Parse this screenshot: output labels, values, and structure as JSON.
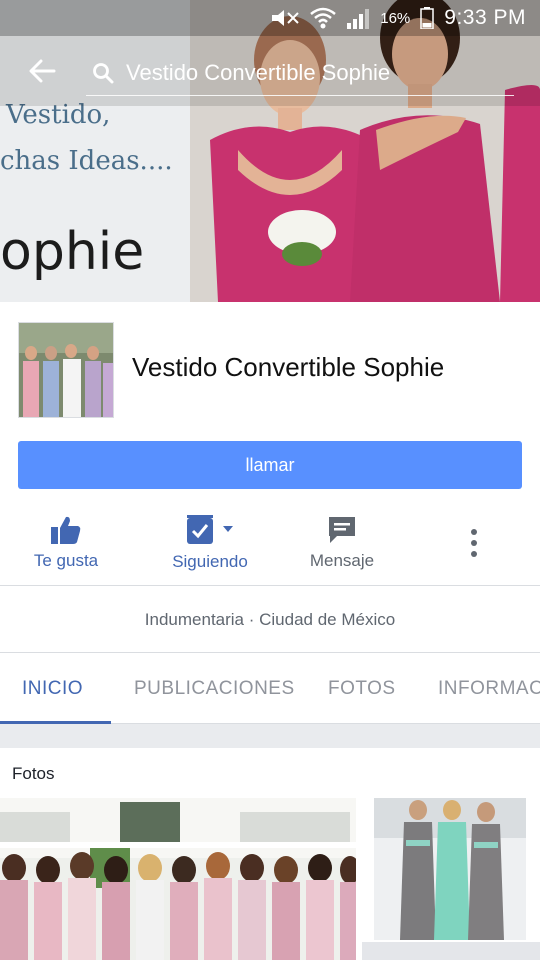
{
  "status_bar": {
    "battery_percent": "16%",
    "time": "9:33 PM"
  },
  "search": {
    "query": "Vestido Convertible Sophie"
  },
  "cover": {
    "text_line1": "Vestido,",
    "text_line2": "chas Ideas....",
    "brand_text": "ophie"
  },
  "page": {
    "name": "Vestido Convertible Sophie",
    "call_label": "llamar",
    "category": "Indumentaria · Ciudad de México"
  },
  "actions": {
    "like_label": "Te gusta",
    "following_label": "Siguiendo",
    "message_label": "Mensaje"
  },
  "tabs": [
    {
      "label": "INICIO",
      "active": true
    },
    {
      "label": "PUBLICACIONES",
      "active": false
    },
    {
      "label": "FOTOS",
      "active": false
    },
    {
      "label": "INFORMACI",
      "active": false
    }
  ],
  "photos": {
    "title": "Fotos"
  },
  "colors": {
    "accent": "#4267b2",
    "call_button": "#5890ff",
    "dress_pink": "#c8326e"
  },
  "icons": [
    "back-arrow-icon",
    "search-icon",
    "like-icon",
    "following-icon",
    "message-icon",
    "more-icon",
    "wifi-icon",
    "signal-icon",
    "battery-icon",
    "mute-icon"
  ]
}
